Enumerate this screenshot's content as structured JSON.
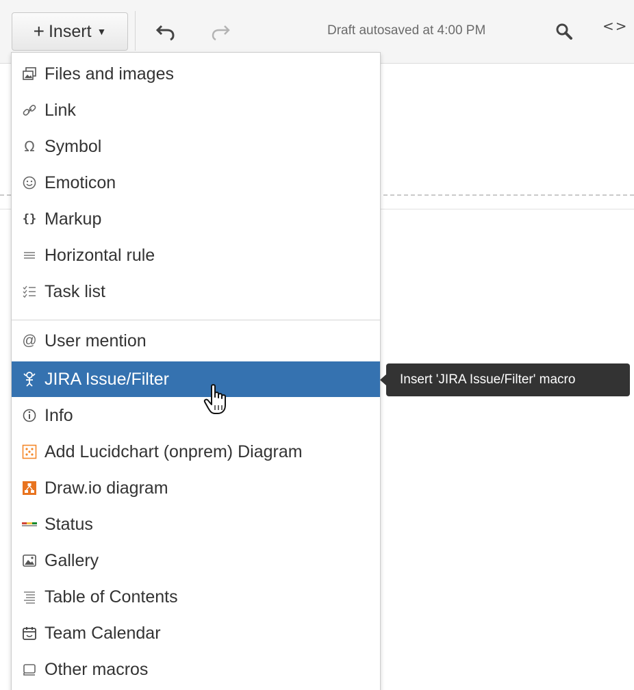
{
  "toolbar": {
    "insert_label": "Insert",
    "draft_status": "Draft autosaved at 4:00 PM",
    "source_label": "<>"
  },
  "menu": {
    "items": [
      {
        "label": "Files and images",
        "icon": "files-images-icon"
      },
      {
        "label": "Link",
        "icon": "link-icon"
      },
      {
        "label": "Symbol",
        "icon": "omega-icon"
      },
      {
        "label": "Emoticon",
        "icon": "smiley-icon"
      },
      {
        "label": "Markup",
        "icon": "braces-icon"
      },
      {
        "label": "Horizontal rule",
        "icon": "horizontal-rule-icon"
      },
      {
        "label": "Task list",
        "icon": "task-list-icon"
      },
      {
        "label": "User mention",
        "icon": "at-icon"
      },
      {
        "label": "JIRA Issue/Filter",
        "icon": "jira-icon"
      },
      {
        "label": "Info",
        "icon": "info-icon"
      },
      {
        "label": "Add Lucidchart (onprem) Diagram",
        "icon": "lucidchart-icon"
      },
      {
        "label": "Draw.io diagram",
        "icon": "drawio-icon"
      },
      {
        "label": "Status",
        "icon": "status-icon"
      },
      {
        "label": "Gallery",
        "icon": "gallery-icon"
      },
      {
        "label": "Table of Contents",
        "icon": "table-of-contents-icon"
      },
      {
        "label": "Team Calendar",
        "icon": "calendar-icon"
      },
      {
        "label": "Other macros",
        "icon": "other-macros-icon"
      }
    ],
    "active_label": "JIRA Issue/Filter"
  },
  "tooltip": {
    "text": "Insert 'JIRA Issue/Filter' macro"
  },
  "colors": {
    "active_background": "#3572b0",
    "tooltip_background": "#333333",
    "lucidchart_orange": "#f5882a",
    "drawio_orange": "#e8731f"
  }
}
